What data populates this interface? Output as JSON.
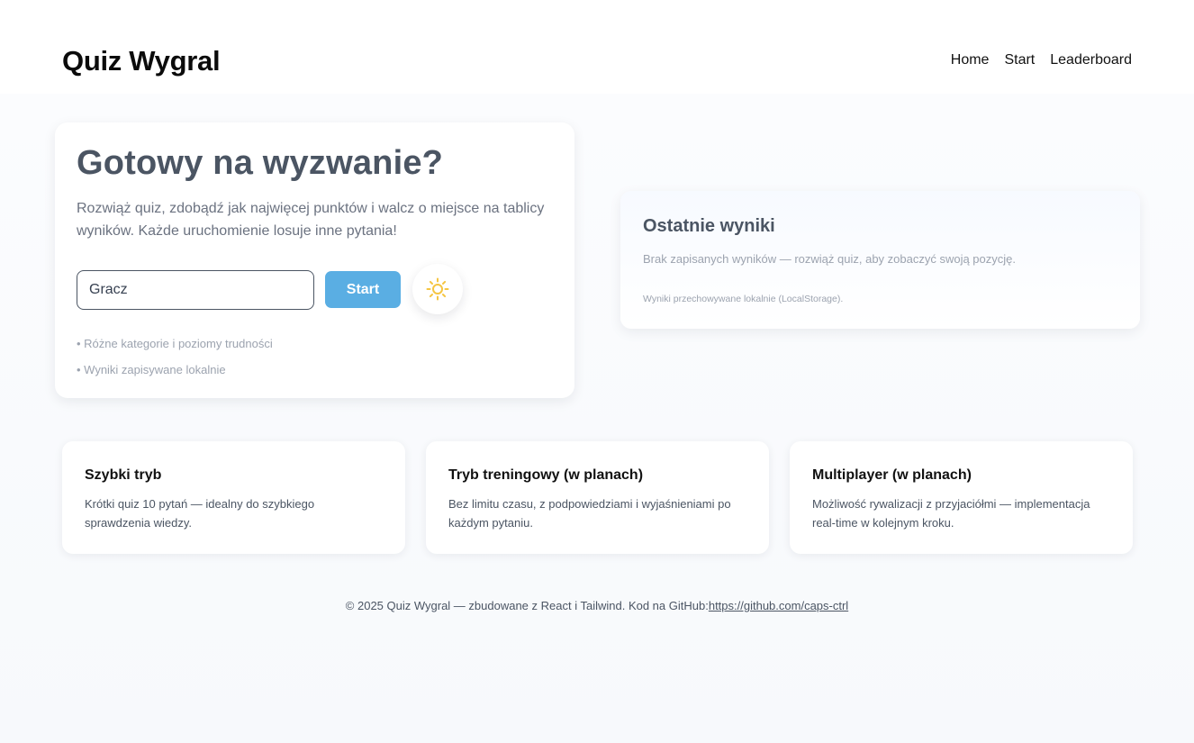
{
  "header": {
    "brand": "Quiz Wygral",
    "nav": [
      {
        "label": "Home"
      },
      {
        "label": "Start"
      },
      {
        "label": "Leaderboard"
      }
    ]
  },
  "hero": {
    "title": "Gotowy na wyzwanie?",
    "description": "Rozwiąż quiz, zdobądź jak najwięcej punktów i walcz o miejsce na tablicy wyników. Każde uruchomienie losuje inne pytania!",
    "name_input": {
      "value": "Gracz",
      "placeholder": ""
    },
    "start_label": "Start",
    "theme_icon": "sun-icon",
    "bullets": [
      "• Różne kategorie i poziomy trudności",
      "• Wyniki zapisywane lokalnie"
    ]
  },
  "results": {
    "title": "Ostatnie wyniki",
    "empty_text": "Brak zapisanych wyników — rozwiąż quiz, aby zobaczyć swoją pozycję.",
    "note": "Wyniki przechowywane lokalnie (LocalStorage)."
  },
  "features": [
    {
      "title": "Szybki tryb",
      "description": "Krótki quiz 10 pytań — idealny do szybkiego sprawdzenia wiedzy."
    },
    {
      "title": "Tryb treningowy (w planach)",
      "description": "Bez limitu czasu, z podpowiedziami i wyjaśnieniami po każdym pytaniu."
    },
    {
      "title": "Multiplayer (w planach)",
      "description": "Możliwość rywalizacji z przyjaciółmi — implementacja real-time w kolejnym kroku."
    }
  ],
  "footer": {
    "text": "© 2025 Quiz Wygral — zbudowane z React i Tailwind. Kod na GitHub:",
    "link": "https://github.com/caps-ctrl"
  },
  "colors": {
    "accent": "#5aaee3",
    "sun": "#f5c542"
  }
}
